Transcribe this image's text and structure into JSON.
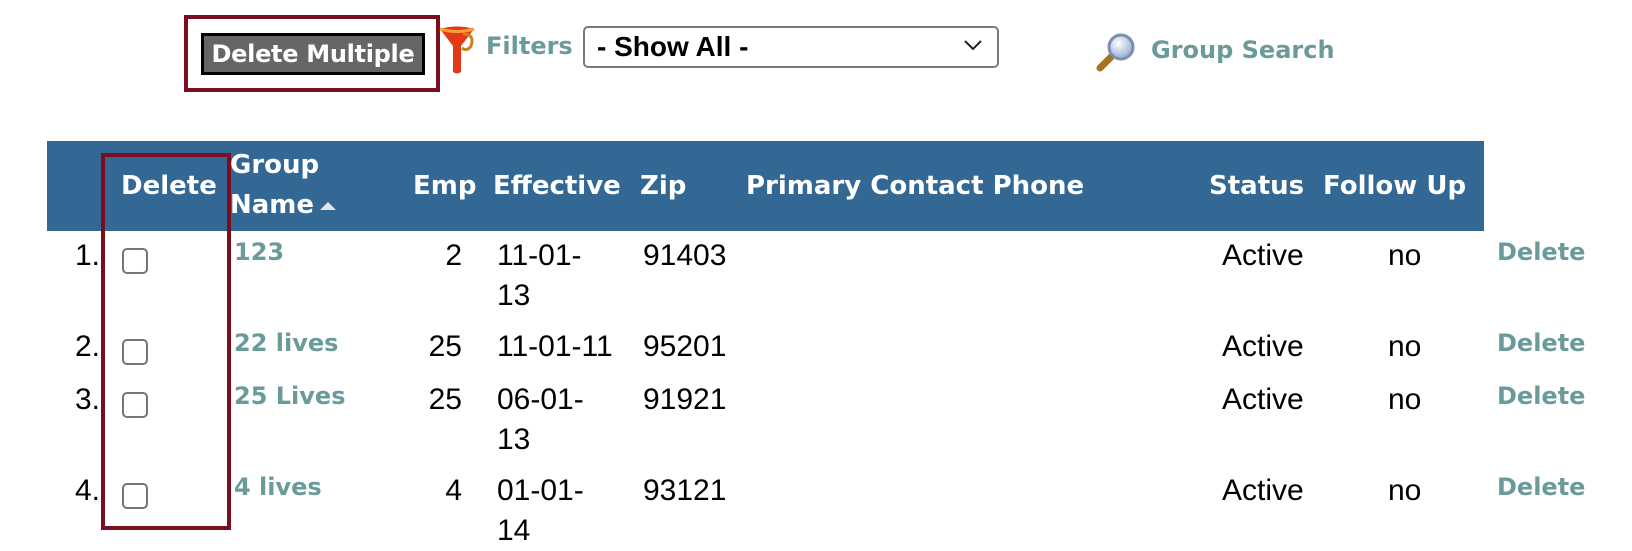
{
  "toolbar": {
    "delete_multiple_label": "Delete Multiple",
    "filters_label": "Filters",
    "filter_select_value": "- Show All -",
    "group_search_label": "Group Search",
    "icons": {
      "filter": "funnel-icon",
      "search": "magnifier-icon",
      "select": "chevron-down-icon"
    }
  },
  "table": {
    "columns": [
      {
        "key": "delete",
        "label": "Delete"
      },
      {
        "key": "group_name",
        "label_line1": "Group",
        "label_line2": "Name",
        "sorted": "ascending"
      },
      {
        "key": "emp",
        "label": "Emp"
      },
      {
        "key": "effective",
        "label": "Effective"
      },
      {
        "key": "zip",
        "label": "Zip"
      },
      {
        "key": "primary_contact_phone",
        "label": "Primary Contact Phone"
      },
      {
        "key": "status",
        "label": "Status"
      },
      {
        "key": "follow_up",
        "label": "Follow Up"
      }
    ],
    "rows": [
      {
        "index": "1.",
        "checked": false,
        "group_name": "123",
        "emp": "2",
        "effective_l1": "11-01-",
        "effective_l2": "13",
        "zip": "91403",
        "phone": "",
        "status": "Active",
        "follow_up": "no",
        "action": "Delete"
      },
      {
        "index": "2.",
        "checked": false,
        "group_name": "22 lives",
        "emp": "25",
        "effective_l1": "11-01-11",
        "effective_l2": "",
        "zip": "95201",
        "phone": "",
        "status": "Active",
        "follow_up": "no",
        "action": "Delete"
      },
      {
        "index": "3.",
        "checked": false,
        "group_name": "25 Lives",
        "emp": "25",
        "effective_l1": "06-01-",
        "effective_l2": "13",
        "zip": "91921",
        "phone": "",
        "status": "Active",
        "follow_up": "no",
        "action": "Delete"
      },
      {
        "index": "4.",
        "checked": false,
        "group_name": "4 lives",
        "emp": "4",
        "effective_l1": "01-01-",
        "effective_l2": "14",
        "zip": "93121",
        "phone": "",
        "status": "Active",
        "follow_up": "no",
        "action": "Delete"
      }
    ]
  },
  "colors": {
    "header_bg": "#336895",
    "link": "#6a9a9a",
    "highlight": "#7a0e1f",
    "button_bg": "#666666"
  }
}
